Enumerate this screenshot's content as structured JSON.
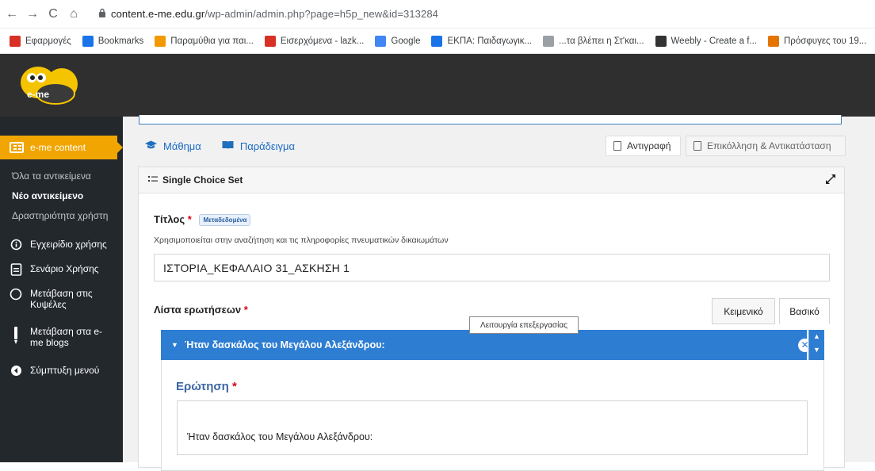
{
  "browser": {
    "nav": {
      "back": "←",
      "forward": "→",
      "reload": "C",
      "home": "⌂"
    },
    "url_host": "content.e-me.edu.gr",
    "url_path": "/wp-admin/admin.php?page=h5p_new&id=313284",
    "bookmarks": [
      {
        "label": "Εφαρμογές",
        "icon": "apps-grid-icon",
        "color": "#d93025"
      },
      {
        "label": "Bookmarks",
        "icon": "star-icon",
        "color": "#1a73e8"
      },
      {
        "label": "Παραμύθια για παι...",
        "icon": "tp-favicon",
        "color": "#f29900"
      },
      {
        "label": "Εισερχόμενα - lazk...",
        "icon": "gmail-icon",
        "color": "#d93025"
      },
      {
        "label": "Google",
        "icon": "google-icon",
        "color": "#4285f4"
      },
      {
        "label": "ΕΚΠΑ: Παιδαγωγικ...",
        "icon": "ekpa-icon",
        "color": "#1a73e8"
      },
      {
        "label": "...τα βλέπει η Στ'και...",
        "icon": "site-icon",
        "color": "#9aa0a6"
      },
      {
        "label": "Weebly - Create a f...",
        "icon": "weebly-icon",
        "color": "#333333"
      },
      {
        "label": "Πρόσφυγες του 19...",
        "icon": "pinwheel-icon",
        "color": "#e37400"
      }
    ]
  },
  "header": {
    "logo_text": "e-me"
  },
  "sidebar": {
    "active": "e-me content",
    "sub": [
      "Όλα τα αντικείμενα",
      "Νέο αντικείμενο",
      "Δραστηριότητα χρήστη"
    ],
    "items": [
      {
        "label": "Εγχειρίδιο χρήσης",
        "icon": "info-icon"
      },
      {
        "label": "Σενάριο Χρήσης",
        "icon": "document-icon"
      },
      {
        "label": "Μετάβαση στις Κυψέλες",
        "icon": "hexagon-icon"
      },
      {
        "label": "Μετάβαση στα e-me blogs",
        "icon": "pen-icon"
      },
      {
        "label": "Σύμπτυξη μενού",
        "icon": "collapse-icon"
      }
    ]
  },
  "main": {
    "tabs": [
      {
        "label": "Μάθημα",
        "icon": "graduation-cap-icon"
      },
      {
        "label": "Παράδειγμα",
        "icon": "book-icon"
      }
    ],
    "copy_label": "Αντιγραφή",
    "paste_label": "Επικόλληση & Αντικατάσταση",
    "editor_title": "Single Choice Set",
    "title_label": "Τίτλος",
    "metadata_badge": "Μεταδεδομένα",
    "title_help": "Χρησιμοποιείται στην αναζήτηση και τις πληροφορίες πνευματικών δικαιωμάτων",
    "title_value": "ΙΣΤΟΡΙΑ_ΚΕΦΑΛΑΙΟ 31_ΑΣΚΗΣΗ 1",
    "questions_label": "Λίστα ερωτήσεων",
    "view_tabs": {
      "text": "Κειμενικό",
      "basic": "Βασικό"
    },
    "tooltip": "Λειτουργία επεξεργασίας",
    "question_bar": "Ήταν δασκάλος του Μεγάλου Αλεξάνδρου:",
    "question_label": "Ερώτηση",
    "question_value": "Ήταν δασκάλος του Μεγάλου Αλεξάνδρου:"
  }
}
